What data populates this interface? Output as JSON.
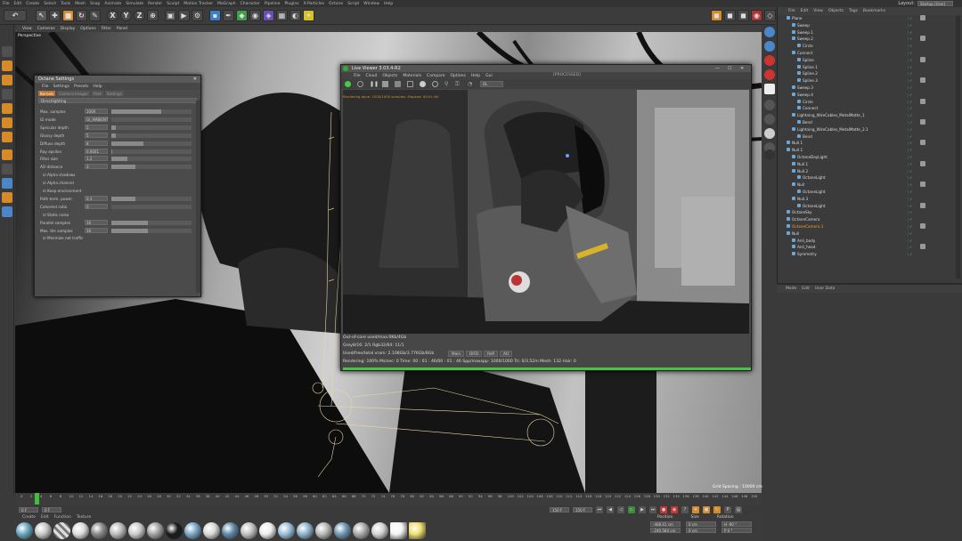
{
  "menubar": {
    "items": [
      "File",
      "Edit",
      "Create",
      "Select",
      "Tools",
      "Mesh",
      "Snap",
      "Animate",
      "Simulate",
      "Render",
      "Sculpt",
      "Motion Tracker",
      "MoGraph",
      "Character",
      "Pipeline",
      "Plugins",
      "X-Particles",
      "Octane",
      "Script",
      "Window",
      "Help"
    ],
    "layout_label": "Layout:",
    "layout_value": "Startup (User)"
  },
  "toolbar": {
    "axis_x": "X",
    "axis_y": "Y",
    "axis_z": "Z"
  },
  "viewport": {
    "menu": [
      "View",
      "Cameras",
      "Display",
      "Options",
      "Filter",
      "Panel"
    ],
    "label": "Perspective",
    "grid_spacing": "Grid Spacing : 10000 cm"
  },
  "octane_settings": {
    "title": "Octane Settings",
    "menu": [
      "File",
      "Settings",
      "Presets",
      "Help"
    ],
    "tabs": [
      "Kernels",
      "Camera Imager",
      "Post",
      "Settings"
    ],
    "kernel": "Directlighting",
    "rows": [
      {
        "label": "Max. samples",
        "value": "1000",
        "fill": 0.62
      },
      {
        "label": "GI mode",
        "value": "GI_AMBIENT",
        "fill": 0
      },
      {
        "label": "Specular depth",
        "value": "5",
        "fill": 0.05
      },
      {
        "label": "Glossy depth",
        "value": "5",
        "fill": 0.05
      },
      {
        "label": "Diffuse depth",
        "value": "8",
        "fill": 0.4
      },
      {
        "label": "Ray epsilon",
        "value": "0.0001",
        "fill": 0.01
      },
      {
        "label": "Filter size",
        "value": "1.2",
        "fill": 0.2
      },
      {
        "label": "AO distance",
        "value": "3",
        "fill": 0.3
      },
      {
        "label": "Alpha shadows",
        "value": "",
        "fill": 0
      },
      {
        "label": "Alpha channel",
        "value": "",
        "fill": 0
      },
      {
        "label": "Keep environment",
        "value": "",
        "fill": 0
      },
      {
        "label": "Path term. power",
        "value": "0.3",
        "fill": 0.3
      },
      {
        "label": "Coherent ratio",
        "value": "0",
        "fill": 0
      },
      {
        "label": "Static noise",
        "value": "",
        "fill": 0
      },
      {
        "label": "Parallel samples",
        "value": "16",
        "fill": 0.45
      },
      {
        "label": "Max. tile samples",
        "value": "16",
        "fill": 0.45
      },
      {
        "label": "Minimize net traffic",
        "value": "",
        "fill": 0
      }
    ]
  },
  "live_viewer": {
    "title": "Live Viewer 3.03.4-R2",
    "menu": [
      "File",
      "Cloud",
      "Objects",
      "Materials",
      "Compare",
      "Options",
      "Help",
      "Gui"
    ],
    "center_label": "[PROCESSED]",
    "dropdown": "DL",
    "status_line": "Rendering done. 1000/1000 samples. Elapsed: 00:01:46",
    "info_lines": [
      "Out-of-core used/max:0Kb/4Gb",
      "Grey8/16: 2/1          Rgb32/64: 11/1",
      "Used/free/total vram: 2.108Gb/3.776Gb/8Gb"
    ],
    "buttons": [
      "Main",
      "DIFD",
      "Refl",
      "AO"
    ],
    "stats": "Rendering: 100%    Ms/sec: 0    Time: 00 : 01 : 46/00 : 01 : 46    Spp/maxspp: 1000/1000    Tri: 0/3.52m    Mesh: 132    Hair: 0"
  },
  "object_manager": {
    "menu": [
      "File",
      "Edit",
      "View",
      "Objects",
      "Tags",
      "Bookmarks"
    ],
    "objects": [
      {
        "name": "Plane",
        "indent": 0
      },
      {
        "name": "Sweep",
        "indent": 1
      },
      {
        "name": "Sweep.1",
        "indent": 1
      },
      {
        "name": "Sweep.2",
        "indent": 1
      },
      {
        "name": "Circle",
        "indent": 2
      },
      {
        "name": "Connect",
        "indent": 1
      },
      {
        "name": "Spline",
        "indent": 2
      },
      {
        "name": "Spline.1",
        "indent": 2
      },
      {
        "name": "Spline.2",
        "indent": 2
      },
      {
        "name": "Spline.3",
        "indent": 2
      },
      {
        "name": "Sweep.3",
        "indent": 1
      },
      {
        "name": "Sweep.4",
        "indent": 1
      },
      {
        "name": "Circle",
        "indent": 2
      },
      {
        "name": "Connect",
        "indent": 2
      },
      {
        "name": "Lightning_WireCables_MetalMatte_1",
        "indent": 1
      },
      {
        "name": "Bend",
        "indent": 2
      },
      {
        "name": "Lightning_WireCables_MetalMatte_2.1",
        "indent": 1
      },
      {
        "name": "Bend",
        "indent": 2
      },
      {
        "name": "Null.1",
        "indent": 0
      },
      {
        "name": "Null.1",
        "indent": 0
      },
      {
        "name": "OctaneDayLight",
        "indent": 1
      },
      {
        "name": "Null.1",
        "indent": 1
      },
      {
        "name": "Null.2",
        "indent": 1
      },
      {
        "name": "OctaneLight",
        "indent": 2
      },
      {
        "name": "Null",
        "indent": 1
      },
      {
        "name": "OctaneLight",
        "indent": 2
      },
      {
        "name": "Null.3",
        "indent": 1
      },
      {
        "name": "OctaneLight",
        "indent": 2
      },
      {
        "name": "OctaneSky",
        "indent": 0
      },
      {
        "name": "OctaneCamera",
        "indent": 0
      },
      {
        "name": "OctaneCamera.1",
        "indent": 0
      },
      {
        "name": "Null",
        "indent": 0
      },
      {
        "name": "Anli_body",
        "indent": 1
      },
      {
        "name": "Anli_head",
        "indent": 1
      },
      {
        "name": "Symmetry",
        "indent": 1
      }
    ]
  },
  "attribute_manager": {
    "menu": [
      "Mode",
      "Edit",
      "User Data"
    ]
  },
  "timeline": {
    "ticks": [
      "0",
      "2",
      "4",
      "6",
      "8",
      "10",
      "12",
      "14",
      "16",
      "18",
      "20",
      "22",
      "24",
      "26",
      "28",
      "30",
      "32",
      "34",
      "36",
      "38",
      "40",
      "42",
      "44",
      "46",
      "48",
      "50",
      "52",
      "54",
      "56",
      "58",
      "60",
      "62",
      "64",
      "66",
      "68",
      "70",
      "72",
      "74",
      "76",
      "78",
      "80",
      "82",
      "84",
      "86",
      "88",
      "90",
      "92",
      "94",
      "96",
      "98",
      "100",
      "102",
      "104",
      "106",
      "108",
      "110",
      "112",
      "114",
      "116",
      "118",
      "120",
      "122",
      "124",
      "126",
      "128",
      "130",
      "132",
      "134",
      "136",
      "138",
      "140",
      "142",
      "144",
      "146",
      "148",
      "150"
    ],
    "current_frame": "0 F",
    "start_field": "0 F",
    "end_field": "150 F",
    "end_field2": "150 F",
    "playhead": 0.04
  },
  "material_manager": {
    "menu": [
      "Create",
      "Edit",
      "Function",
      "Texture"
    ]
  },
  "coordinates": {
    "headers": [
      "Position",
      "Size",
      "Rotation"
    ],
    "rows": [
      {
        "pos": "-408.41 cm",
        "size": "0 cm",
        "rot": "H  -90 °"
      },
      {
        "pos": "-240.584 cm",
        "size": "0 cm",
        "rot": "P  0 °"
      }
    ]
  }
}
